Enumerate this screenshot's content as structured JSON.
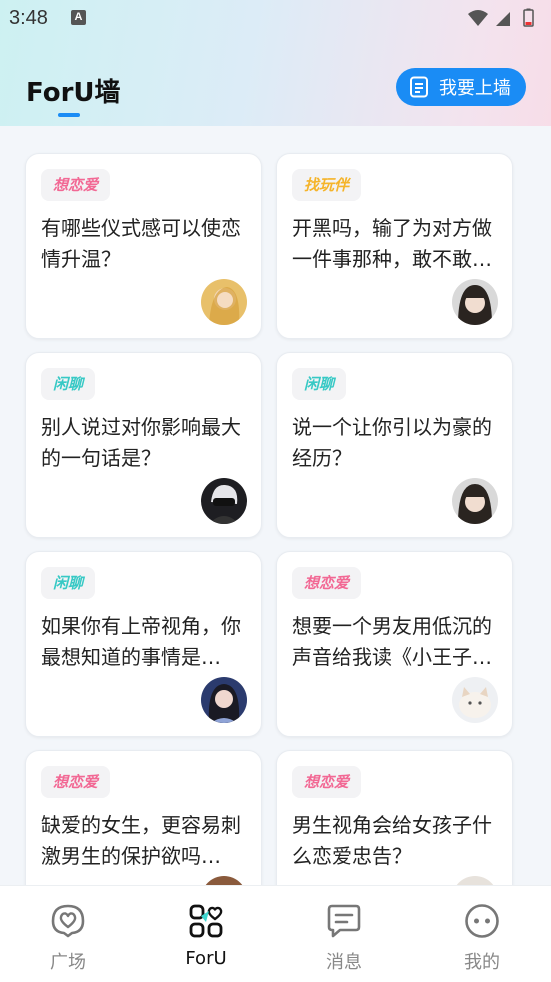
{
  "status_bar": {
    "time": "3:48",
    "notification_icon": "A"
  },
  "header": {
    "title": "ForU墙",
    "post_button_label": "我要上墙"
  },
  "cards": [
    {
      "tag": "想恋爱",
      "tag_type": "love",
      "text": "有哪些仪式感可以使恋情升温？",
      "avatar": "avatar-woman-blonde"
    },
    {
      "tag": "找玩伴",
      "tag_type": "play",
      "text": "开黑吗，输了为对方做一件事那种，敢不敢…",
      "avatar": "avatar-girl-bangs"
    },
    {
      "tag": "闲聊",
      "tag_type": "chat",
      "text": "别人说过对你影响最大的一句话是？",
      "avatar": "avatar-anime-boy"
    },
    {
      "tag": "闲聊",
      "tag_type": "chat",
      "text": "说一个让你引以为豪的经历？",
      "avatar": "avatar-girl-bangs"
    },
    {
      "tag": "闲聊",
      "tag_type": "chat",
      "text": "如果你有上帝视角，你最想知道的事情是…",
      "avatar": "avatar-woman-dark-hair"
    },
    {
      "tag": "想恋爱",
      "tag_type": "love",
      "text": "想要一个男友用低沉的声音给我读《小王子…",
      "avatar": "avatar-white-cat"
    },
    {
      "tag": "想恋爱",
      "tag_type": "love",
      "text": "缺爱的女生，更容易刺激男生的保护欲吗…",
      "avatar": "avatar-partial"
    },
    {
      "tag": "想恋爱",
      "tag_type": "love",
      "text": "男生视角会给女孩子什么恋爱忠告？",
      "avatar": "avatar-partial"
    }
  ],
  "tabs": [
    {
      "label": "广场",
      "icon": "heart-bubble-icon",
      "active": false
    },
    {
      "label": "ForU",
      "icon": "foru-grid-icon",
      "active": true
    },
    {
      "label": "消息",
      "icon": "message-icon",
      "active": false
    },
    {
      "label": "我的",
      "icon": "face-icon",
      "active": false
    }
  ],
  "colors": {
    "accent": "#1a8cf5",
    "love_tag": "#f26894",
    "chat_tag": "#37c9c5",
    "play_tag": "#f5b42a"
  }
}
